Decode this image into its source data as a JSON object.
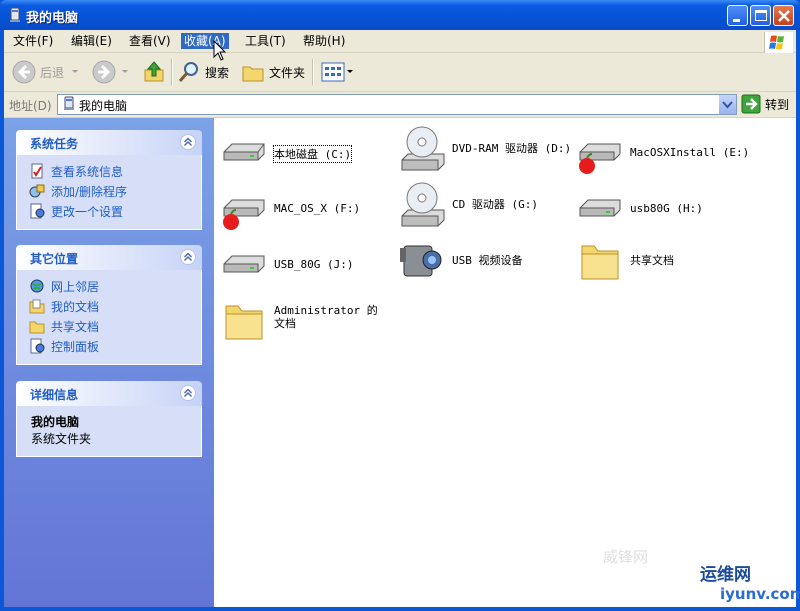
{
  "window": {
    "title": "我的电脑"
  },
  "menu": [
    {
      "label": "文件(F)"
    },
    {
      "label": "编辑(E)"
    },
    {
      "label": "查看(V)"
    },
    {
      "label": "收藏(A)"
    },
    {
      "label": "工具(T)"
    },
    {
      "label": "帮助(H)"
    }
  ],
  "toolbar": {
    "back": "后退",
    "search": "搜索",
    "folders": "文件夹"
  },
  "address": {
    "label": "地址(D)",
    "value": "我的电脑",
    "go": "转到"
  },
  "panels": {
    "system_tasks": {
      "title": "系统任务",
      "items": [
        "查看系统信息",
        "添加/删除程序",
        "更改一个设置"
      ]
    },
    "other_places": {
      "title": "其它位置",
      "items": [
        "网上邻居",
        "我的文档",
        "共享文档",
        "控制面板"
      ]
    },
    "details": {
      "title": "详细信息",
      "name": "我的电脑",
      "type": "系统文件夹"
    }
  },
  "items": [
    {
      "label": "本地磁盘 (C:)",
      "icon": "hard-drive-icon"
    },
    {
      "label": "DVD-RAM 驱动器 (D:)",
      "icon": "optical-drive-icon"
    },
    {
      "label": "MacOSXInstall (E:)",
      "icon": "mac-drive-icon"
    },
    {
      "label": "MAC_OS_X (F:)",
      "icon": "mac-drive-icon"
    },
    {
      "label": "CD 驱动器 (G:)",
      "icon": "optical-drive-icon"
    },
    {
      "label": "usb80G (H:)",
      "icon": "hard-drive-icon"
    },
    {
      "label": "USB_80G (J:)",
      "icon": "hard-drive-icon"
    },
    {
      "label": "USB 视频设备",
      "icon": "video-camera-icon"
    },
    {
      "label": "共享文档",
      "icon": "folder-icon"
    },
    {
      "label": "Administrator 的文档",
      "icon": "folder-icon"
    }
  ],
  "watermark": {
    "line1": "威锋网",
    "line2": "运维网",
    "line3": "iyunv.com"
  }
}
